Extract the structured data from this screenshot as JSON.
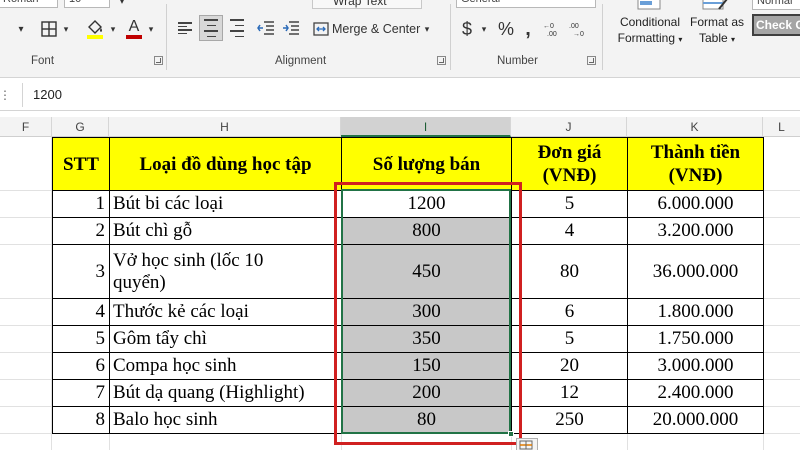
{
  "ribbon": {
    "font_group": {
      "font_name": "Roman",
      "font_size": "10",
      "label": "Font"
    },
    "alignment_group": {
      "wrap_text": "Wrap Text",
      "merge_center": "Merge & Center",
      "label": "Alignment"
    },
    "number_group": {
      "format": "General",
      "currency": "$",
      "percent": "%",
      "label": "Number"
    },
    "styles_group": {
      "conditional_formatting_line1": "Conditional",
      "conditional_formatting_line2": "Formatting",
      "format_as_table_line1": "Format as",
      "format_as_table_line2": "Table",
      "cell_style_top": "Normal",
      "check_cell": "Check C"
    },
    "colors": {
      "highlight": "#ffff00",
      "font_color": "#c00000"
    }
  },
  "formula_bar": {
    "value": "1200"
  },
  "columns": [
    "F",
    "G",
    "H",
    "I",
    "J",
    "K",
    "L"
  ],
  "selected_column": "I",
  "table": {
    "headers": {
      "stt": "STT",
      "item": "Loại đồ dùng học tập",
      "quantity": "Số lượng bán",
      "unit_price_line1": "Đơn giá",
      "unit_price_line2": "(VNĐ)",
      "total_line1": "Thành tiền",
      "total_line2": "(VNĐ)"
    },
    "rows": [
      {
        "stt": "1",
        "item": "Bút bi các loại",
        "quantity": "1200",
        "price": "5",
        "total": "6.000.000"
      },
      {
        "stt": "2",
        "item": "Bút chì gỗ",
        "quantity": "800",
        "price": "4",
        "total": "3.200.000"
      },
      {
        "stt": "3",
        "item_line1": "Vở học sinh (lốc 10",
        "item_line2": "quyển)",
        "quantity": "450",
        "price": "80",
        "total": "36.000.000"
      },
      {
        "stt": "4",
        "item": "Thước kẻ các loại",
        "quantity": "300",
        "price": "6",
        "total": "1.800.000"
      },
      {
        "stt": "5",
        "item": "Gôm tẩy chì",
        "quantity": "350",
        "price": "5",
        "total": "1.750.000"
      },
      {
        "stt": "6",
        "item": "Compa học sinh",
        "quantity": "150",
        "price": "20",
        "total": "3.000.000"
      },
      {
        "stt": "7",
        "item": "Bút dạ quang (Highlight)",
        "quantity": "200",
        "price": "12",
        "total": "2.400.000"
      },
      {
        "stt": "8",
        "item": "Balo học sinh",
        "quantity": "80",
        "price": "250",
        "total": "20.000.000"
      }
    ]
  },
  "colors": {
    "header_fill": "#ffff00",
    "selection_fill": "#c8c8c8",
    "selection_border": "#217346",
    "annotation_box": "#d02020"
  }
}
